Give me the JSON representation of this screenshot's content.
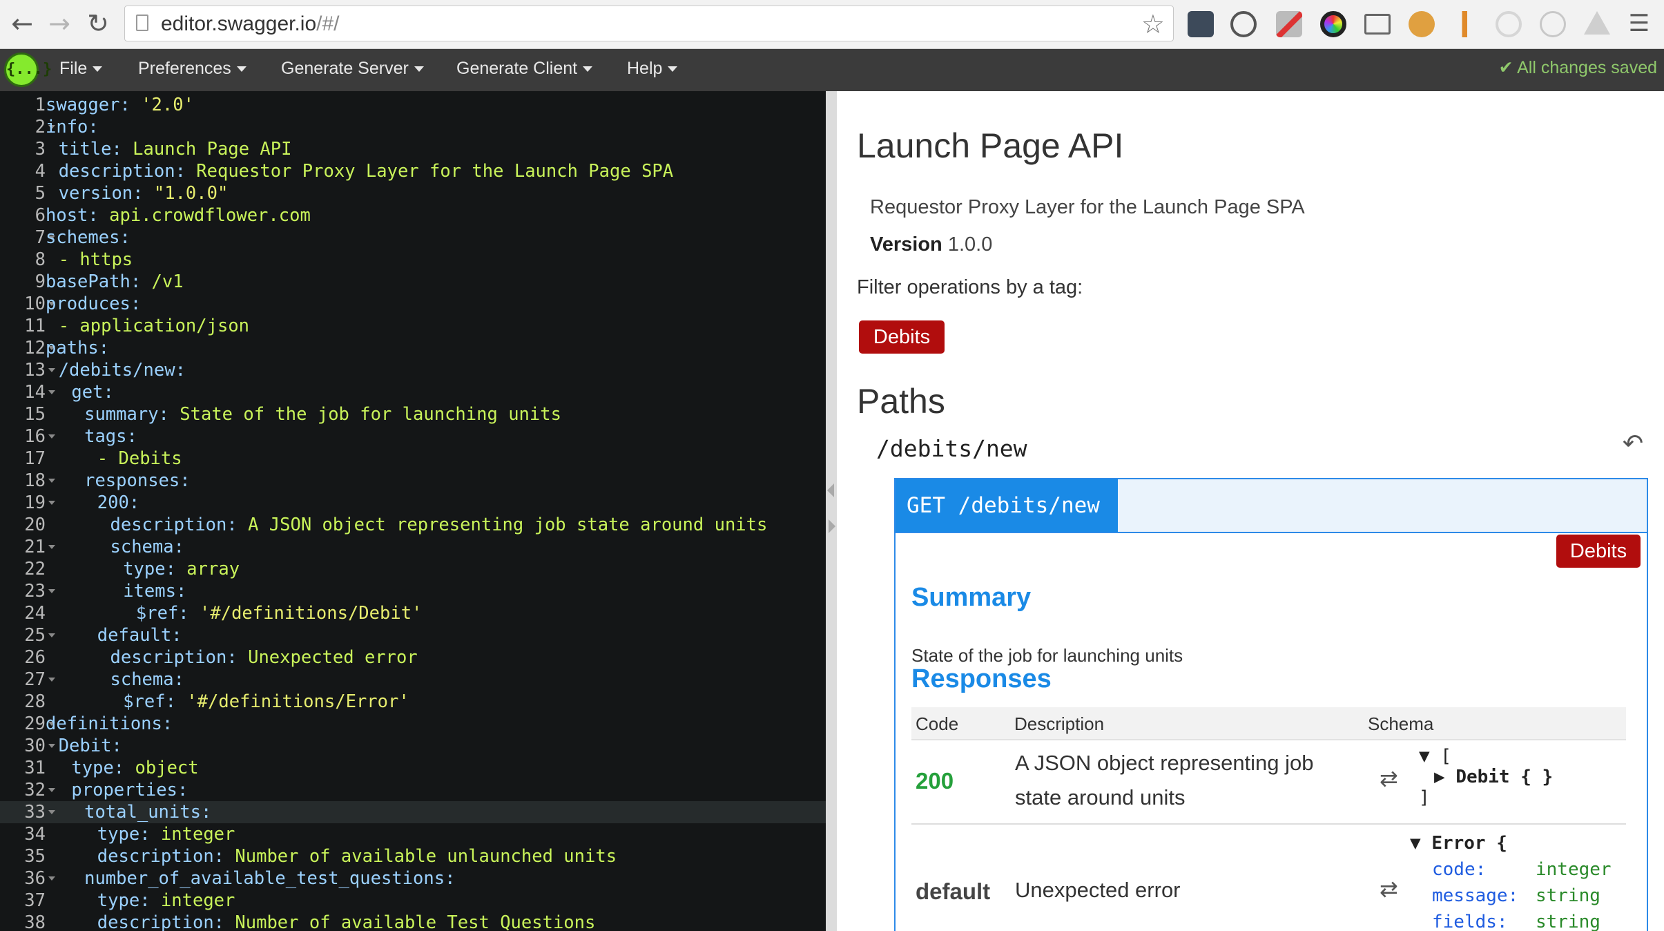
{
  "browser": {
    "url_host": "editor.swagger.io",
    "url_path": "/#/"
  },
  "header": {
    "logo": "{...}",
    "menu": [
      "File",
      "Preferences",
      "Generate Server",
      "Generate Client",
      "Help"
    ],
    "status": "All changes saved"
  },
  "editor": {
    "active_line": 33,
    "lines": [
      {
        "n": "1",
        "fold": false,
        "ind": 0,
        "key": "swagger:",
        "val": " '2.0'"
      },
      {
        "n": "2",
        "fold": true,
        "ind": 0,
        "key": "info:",
        "val": ""
      },
      {
        "n": "3",
        "fold": false,
        "ind": 1,
        "key": "title:",
        "val": " Launch Page API"
      },
      {
        "n": "4",
        "fold": false,
        "ind": 1,
        "key": "description:",
        "val": " Requestor Proxy Layer for the Launch Page SPA"
      },
      {
        "n": "5",
        "fold": false,
        "ind": 1,
        "key": "version:",
        "val": " \"1.0.0\""
      },
      {
        "n": "6",
        "fold": false,
        "ind": 0,
        "key": "host:",
        "val": " api.crowdflower.com"
      },
      {
        "n": "7",
        "fold": true,
        "ind": 0,
        "key": "schemes:",
        "val": ""
      },
      {
        "n": "8",
        "fold": false,
        "ind": 1,
        "key": "",
        "val": "- https"
      },
      {
        "n": "9",
        "fold": false,
        "ind": 0,
        "key": "basePath:",
        "val": " /v1"
      },
      {
        "n": "10",
        "fold": true,
        "ind": 0,
        "key": "produces:",
        "val": ""
      },
      {
        "n": "11",
        "fold": false,
        "ind": 1,
        "key": "",
        "val": "- application/json"
      },
      {
        "n": "12",
        "fold": true,
        "ind": 0,
        "key": "paths:",
        "val": ""
      },
      {
        "n": "13",
        "fold": true,
        "ind": 1,
        "key": "/debits/new:",
        "val": ""
      },
      {
        "n": "14",
        "fold": true,
        "ind": 2,
        "key": "get:",
        "val": ""
      },
      {
        "n": "15",
        "fold": false,
        "ind": 3,
        "key": "summary:",
        "val": " State of the job for launching units"
      },
      {
        "n": "16",
        "fold": true,
        "ind": 3,
        "key": "tags:",
        "val": ""
      },
      {
        "n": "17",
        "fold": false,
        "ind": 4,
        "key": "",
        "val": "- Debits"
      },
      {
        "n": "18",
        "fold": true,
        "ind": 3,
        "key": "responses:",
        "val": ""
      },
      {
        "n": "19",
        "fold": true,
        "ind": 4,
        "key": "200:",
        "val": ""
      },
      {
        "n": "20",
        "fold": false,
        "ind": 5,
        "key": "description:",
        "val": " A JSON object representing job state around units"
      },
      {
        "n": "21",
        "fold": true,
        "ind": 5,
        "key": "schema:",
        "val": ""
      },
      {
        "n": "22",
        "fold": false,
        "ind": 6,
        "key": "type:",
        "val": " array"
      },
      {
        "n": "23",
        "fold": true,
        "ind": 6,
        "key": "items:",
        "val": ""
      },
      {
        "n": "24",
        "fold": false,
        "ind": 7,
        "key": "$ref:",
        "val": " '#/definitions/Debit'"
      },
      {
        "n": "25",
        "fold": true,
        "ind": 4,
        "key": "default:",
        "val": ""
      },
      {
        "n": "26",
        "fold": false,
        "ind": 5,
        "key": "description:",
        "val": " Unexpected error"
      },
      {
        "n": "27",
        "fold": true,
        "ind": 5,
        "key": "schema:",
        "val": ""
      },
      {
        "n": "28",
        "fold": false,
        "ind": 6,
        "key": "$ref:",
        "val": " '#/definitions/Error'"
      },
      {
        "n": "29",
        "fold": true,
        "ind": 0,
        "key": "definitions:",
        "val": ""
      },
      {
        "n": "30",
        "fold": true,
        "ind": 1,
        "key": "Debit:",
        "val": ""
      },
      {
        "n": "31",
        "fold": false,
        "ind": 2,
        "key": "type:",
        "val": " object"
      },
      {
        "n": "32",
        "fold": true,
        "ind": 2,
        "key": "properties:",
        "val": ""
      },
      {
        "n": "33",
        "fold": true,
        "ind": 3,
        "key": "total_units:",
        "val": ""
      },
      {
        "n": "34",
        "fold": false,
        "ind": 4,
        "key": "type:",
        "val": " integer"
      },
      {
        "n": "35",
        "fold": false,
        "ind": 4,
        "key": "description:",
        "val": " Number of available unlaunched units"
      },
      {
        "n": "36",
        "fold": true,
        "ind": 3,
        "key": "number_of_available_test_questions:",
        "val": ""
      },
      {
        "n": "37",
        "fold": false,
        "ind": 4,
        "key": "type:",
        "val": " integer"
      },
      {
        "n": "38",
        "fold": false,
        "ind": 4,
        "key": "description:",
        "val": " Number of available Test Questions"
      }
    ]
  },
  "preview": {
    "title": "Launch Page API",
    "description": "Requestor Proxy Layer for the Launch Page SPA",
    "version_label": "Version",
    "version_value": "1.0.0",
    "filter_label": "Filter operations by a tag:",
    "filter_tag": "Debits",
    "paths_title": "Paths",
    "path_name": "/debits/new",
    "operation": {
      "method_path": "GET /debits/new",
      "tag": "Debits",
      "summary_title": "Summary",
      "summary_text": "State of the job for launching units",
      "responses_title": "Responses",
      "columns": [
        "Code",
        "Description",
        "Schema"
      ],
      "responses": [
        {
          "code": "200",
          "description_line1": "A JSON object representing job",
          "description_line2": "state around units",
          "schema_open": "[",
          "schema_item": "Debit { }",
          "schema_close": "]"
        },
        {
          "code": "default",
          "description": "Unexpected error",
          "schema_name": "Error {",
          "fields": [
            {
              "name": "code:",
              "type": "integer"
            },
            {
              "name": "message:",
              "type": "string"
            },
            {
              "name": "fields:",
              "type": "string"
            }
          ]
        }
      ]
    }
  }
}
